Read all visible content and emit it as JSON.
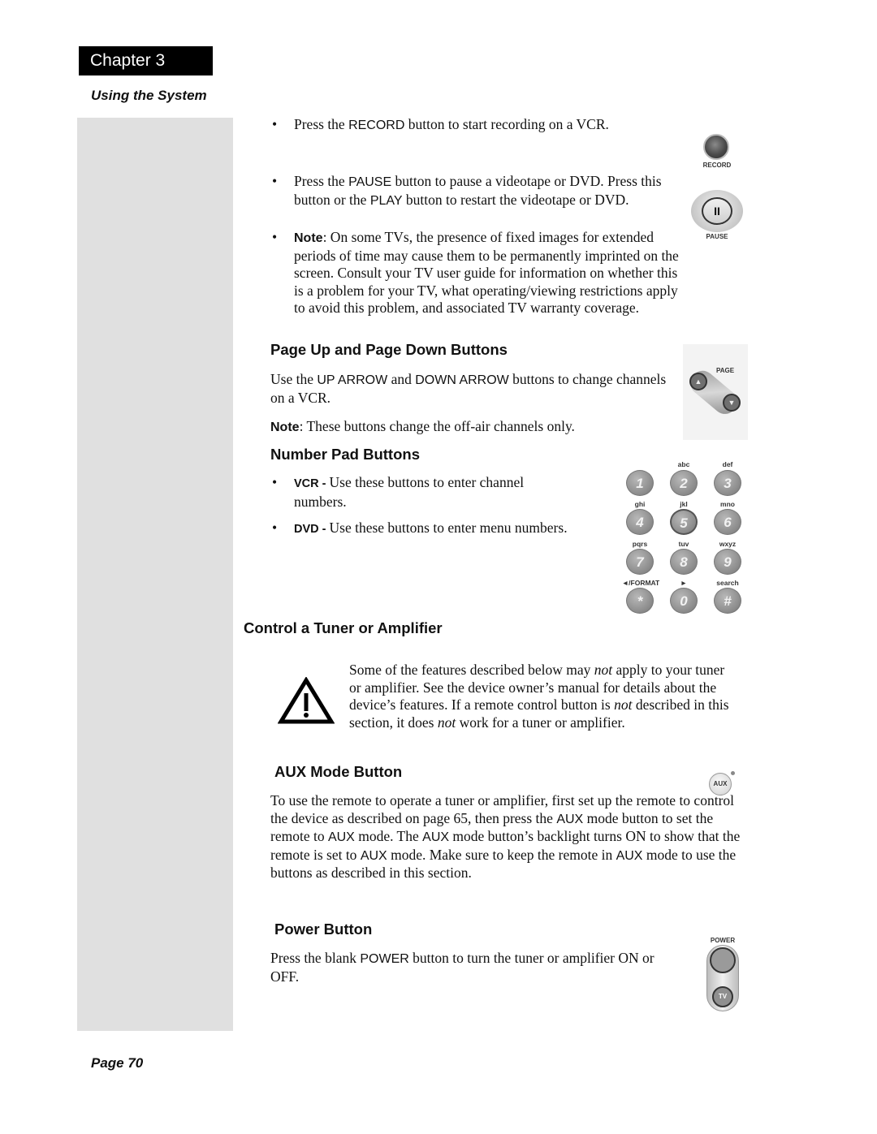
{
  "header": {
    "chapter": "Chapter 3",
    "section": "Using the System"
  },
  "footer": {
    "page": "Page 70"
  },
  "record_pause": {
    "bullets": [
      {
        "prefix": "Press the ",
        "key": "RECORD",
        "suffix": " button to start recording on a VCR."
      },
      {
        "prefix": "Press the ",
        "key": "PAUSE",
        "middle": " button to pause a videotape or DVD. Press this button or the ",
        "key2": "PLAY",
        "suffix": " button to restart the videotape or DVD."
      },
      {
        "label": "Note",
        "text": ": On some TVs, the presence of fixed images for extended periods of time may cause them to be permanently imprinted on the screen. Consult your TV user guide for information on whether this is a problem for your TV, what operating/viewing restrictions apply to avoid this problem, and associated TV warranty coverage."
      }
    ],
    "record_caption": "RECORD",
    "pause_caption": "PAUSE",
    "pause_glyph": "II"
  },
  "page_buttons": {
    "heading": "Page Up and Page Down Buttons",
    "text_prefix": "Use the ",
    "key1": "UP ARROW",
    "text_mid": " and ",
    "key2": "DOWN ARROW",
    "text_suffix": " buttons to change channels on a VCR.",
    "note_label": "Note",
    "note_text": ": These buttons change the off-air channels only.",
    "caption": "PAGE",
    "up_glyph": "▲",
    "down_glyph": "▼"
  },
  "number_pad": {
    "heading": "Number Pad Buttons",
    "bullets": [
      {
        "label": "VCR - ",
        "text": "Use these buttons to enter channel numbers."
      },
      {
        "label": "DVD - ",
        "text": "Use these buttons to enter menu numbers."
      }
    ],
    "keys": [
      {
        "label": "",
        "digit": "1"
      },
      {
        "label": "abc",
        "digit": "2"
      },
      {
        "label": "def",
        "digit": "3"
      },
      {
        "label": "ghi",
        "digit": "4"
      },
      {
        "label": "jkl",
        "digit": "5"
      },
      {
        "label": "mno",
        "digit": "6"
      },
      {
        "label": "pqrs",
        "digit": "7"
      },
      {
        "label": "tuv",
        "digit": "8"
      },
      {
        "label": "wxyz",
        "digit": "9"
      },
      {
        "label": "◄/FORMAT",
        "digit": "*"
      },
      {
        "label": "►",
        "digit": "0"
      },
      {
        "label": "search",
        "digit": "#"
      }
    ]
  },
  "tuner": {
    "heading": "Control a Tuner or Amplifier",
    "warning": {
      "t1": "Some of the features described below may ",
      "em1": "not",
      "t2": " apply to your tuner or amplifier. See the device owner’s manual for details about the device’s features. If a remote control button is ",
      "em2": "not",
      "t3": " described in this section, it does ",
      "em3": "not",
      "t4": " work for a tuner or amplifier."
    }
  },
  "aux": {
    "heading": "AUX Mode Button",
    "p1": "To use the remote to operate a tuner or amplifier, first set up the remote to control the device as described on page 65, then press the ",
    "k1": "AUX",
    "p2": " mode button to set the remote to ",
    "k2": "AUX",
    "p3": " mode. The ",
    "k3": "AUX",
    "p4": " mode button’s backlight turns ON to show that the remote is set to ",
    "k4": "AUX",
    "p5": " mode. Make sure to keep the remote in ",
    "k5": "AUX",
    "p6": " mode to use the buttons as described in this section.",
    "button_label": "AUX"
  },
  "power": {
    "heading": "Power Button",
    "prefix": "Press the blank ",
    "key": "POWER",
    "suffix": " button to turn the tuner or amplifier ON or OFF.",
    "caption": "POWER",
    "tv_label": "TV"
  }
}
